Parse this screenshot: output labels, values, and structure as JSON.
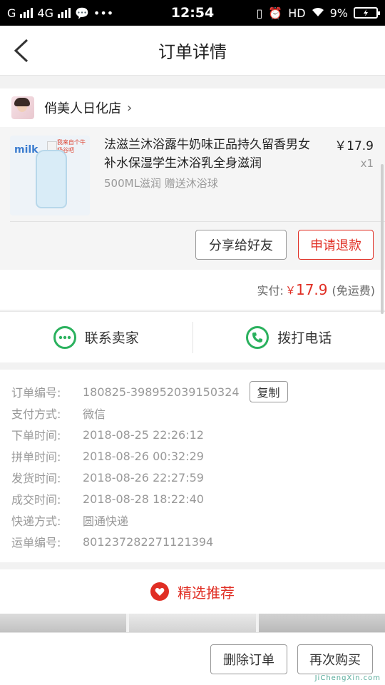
{
  "status_bar": {
    "carrier": "G",
    "network": "4G",
    "time": "12:54",
    "hd": "HD",
    "battery": "9%"
  },
  "header": {
    "title": "订单详情"
  },
  "store": {
    "name": "俏美人日化店"
  },
  "product": {
    "title": "法滋兰沐浴露牛奶味正品持久留香男女补水保湿学生沐浴乳全身滋润",
    "spec": "500ML滋润 赠送沐浴球",
    "price": "￥17.9",
    "quantity": "x1",
    "image_badge": "milk",
    "image_caption": "我来自个牛奶谷吧"
  },
  "actions": {
    "share": "分享给好友",
    "refund": "申请退款"
  },
  "payment": {
    "label": "实付:",
    "currency": "￥",
    "amount": "17.9",
    "shipping_note": "(免运费)"
  },
  "contact": {
    "seller": "联系卖家",
    "call": "拨打电话"
  },
  "order": {
    "copy_label": "复制",
    "rows": [
      {
        "key": "订单编号:",
        "value": "180825-398952039150324"
      },
      {
        "key": "支付方式:",
        "value": "微信"
      },
      {
        "key": "下单时间:",
        "value": "2018-08-25 22:26:12"
      },
      {
        "key": "拼单时间:",
        "value": "2018-08-26 00:32:29"
      },
      {
        "key": "发货时间:",
        "value": "2018-08-26 22:27:59"
      },
      {
        "key": "成交时间:",
        "value": "2018-08-28 18:22:40"
      },
      {
        "key": "快递方式:",
        "value": "圆通快递"
      },
      {
        "key": "运单编号:",
        "value": "801237282271121394"
      }
    ]
  },
  "recommend": {
    "title": "精选推荐"
  },
  "bottom_bar": {
    "delete": "删除订单",
    "rebuy": "再次购买"
  },
  "watermark": "JiChengXin.com",
  "colors": {
    "accent": "#e02e24",
    "green": "#2bb15e"
  }
}
